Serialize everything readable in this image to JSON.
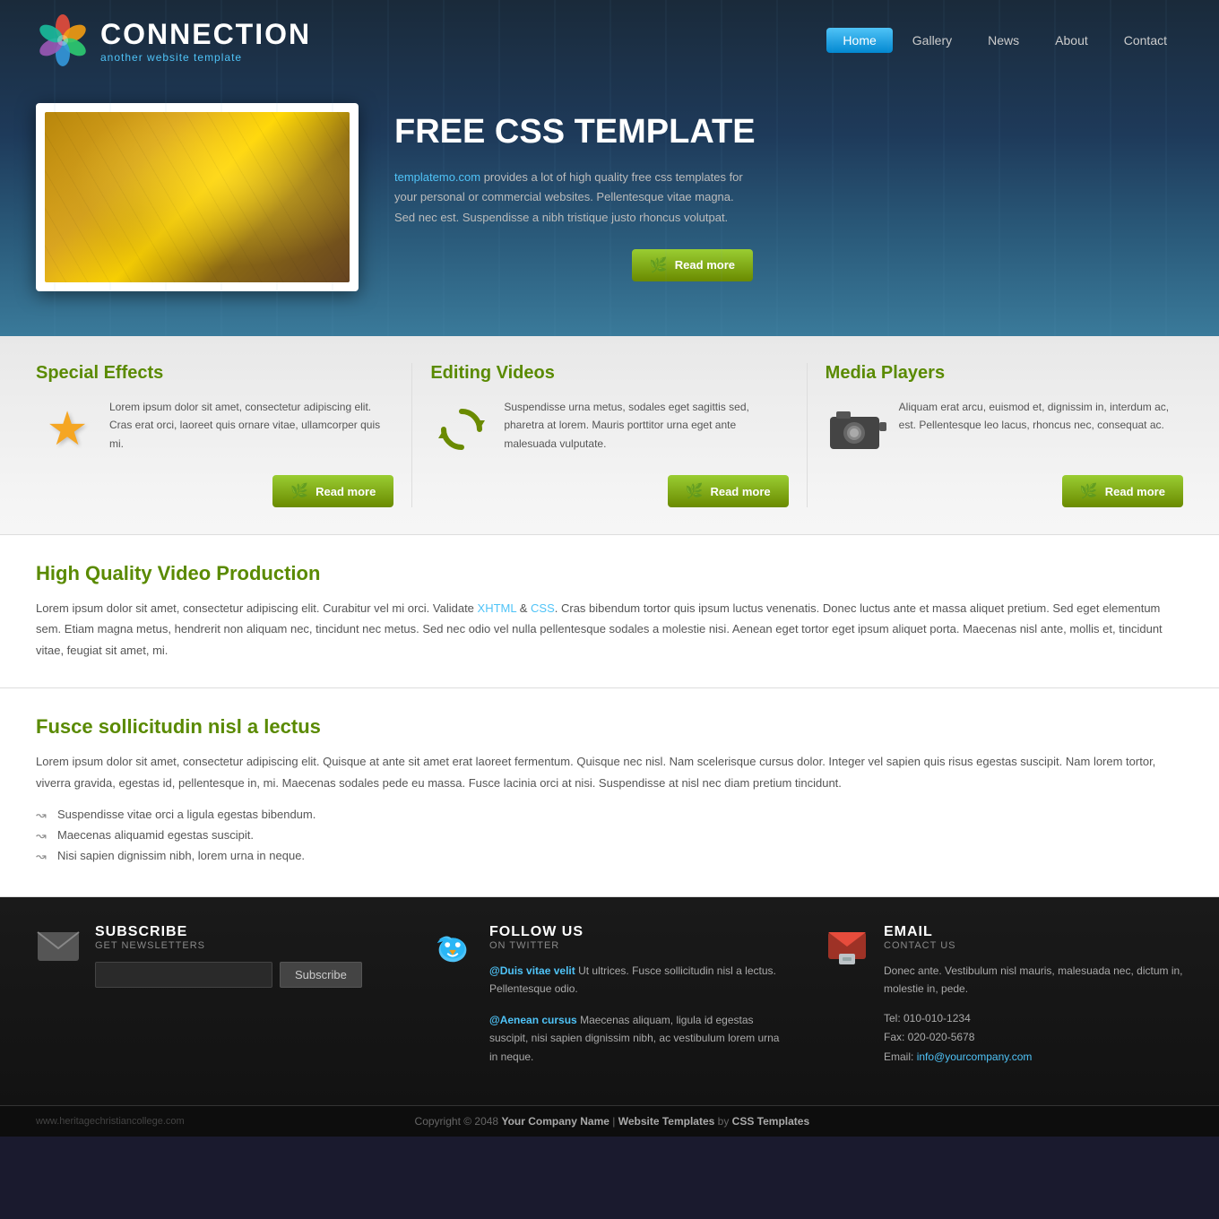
{
  "header": {
    "logo_title": "CONNECTION",
    "logo_subtitle": "another website template",
    "nav": {
      "items": [
        {
          "label": "Home",
          "active": true
        },
        {
          "label": "Gallery",
          "active": false
        },
        {
          "label": "News",
          "active": false
        },
        {
          "label": "About",
          "active": false
        },
        {
          "label": "Contact",
          "active": false
        }
      ]
    }
  },
  "hero": {
    "title": "FREE CSS TEMPLATE",
    "desc_link": "templatemo.com",
    "desc": " provides a lot of high quality free css templates for your personal or commercial websites. Pellentesque vitae magna. Sed nec est. Suspendisse a nibh tristique justo rhoncus volutpat.",
    "read_more": "Read more"
  },
  "features": [
    {
      "title": "Special Effects",
      "text": "Lorem ipsum dolor sit amet, consectetur adipiscing elit. Cras erat orci, laoreet quis ornare vitae, ullamcorper quis mi.",
      "read_more": "Read more"
    },
    {
      "title": "Editing Videos",
      "text": "Suspendisse urna metus, sodales eget sagittis sed, pharetra at lorem. Mauris porttitor urna eget ante malesuada vulputate.",
      "read_more": "Read more"
    },
    {
      "title": "Media Players",
      "text": "Aliquam erat arcu, euismod et, dignissim in, interdum ac, est. Pellentesque leo lacus, rhoncus nec, consequat ac.",
      "read_more": "Read more"
    }
  ],
  "article1": {
    "title": "High Quality Video Production",
    "text": "Lorem ipsum dolor sit amet, consectetur adipiscing elit. Curabitur vel mi orci. Validate ",
    "link1": "XHTML",
    "link1_url": "#",
    "text2": " & ",
    "link2": "CSS",
    "link2_url": "#",
    "text3": ". Cras bibendum tortor quis ipsum luctus venenatis. Donec luctus ante et massa aliquet pretium. Sed eget elementum sem. Etiam magna metus, hendrerit non aliquam nec, tincidunt nec metus. Sed nec odio vel nulla pellentesque sodales a molestie nisi. Aenean eget tortor eget ipsum aliquet porta. Maecenas nisl ante, mollis et, tincidunt vitae, feugiat sit amet, mi."
  },
  "article2": {
    "title": "Fusce sollicitudin nisl a lectus",
    "text": "Lorem ipsum dolor sit amet, consectetur adipiscing elit. Quisque at ante sit amet erat laoreet fermentum. Quisque nec nisl. Nam scelerisque cursus dolor. Integer vel sapien quis risus egestas suscipit. Nam lorem tortor, viverra gravida, egestas id, pellentesque in, mi. Maecenas sodales pede eu massa. Fusce lacinia orci at nisi. Suspendisse at nisl nec diam pretium tincidunt.",
    "list": [
      "Suspendisse vitae orci a ligula egestas bibendum.",
      "Maecenas aliquamid egestas suscipit.",
      "Nisi sapien dignissim nibh, lorem urna in neque."
    ]
  },
  "footer": {
    "subscribe": {
      "title": "SUBSCRIBE",
      "subtitle": "GET NEWSLETTERS",
      "input_placeholder": "",
      "btn_label": "Subscribe"
    },
    "follow": {
      "title": "FOLLOW US",
      "subtitle": "ON TWITTER",
      "entry1_link": "@Duis vitae velit",
      "entry1_text": " Ut ultrices. Fusce sollicitudin nisl a lectus. Pellentesque odio.",
      "entry2_link": "@Aenean cursus",
      "entry2_text": " Maecenas aliquam, ligula id egestas suscipit, nisi sapien dignissim nibh, ac vestibulum lorem urna in neque."
    },
    "email": {
      "title": "EMAIL",
      "subtitle": "CONTACT US",
      "desc": "Donec ante. Vestibulum nisl mauris, malesuada nec, dictum in, molestie in, pede.",
      "tel": "Tel: 010-010-1234",
      "fax": "Fax: 020-020-5678",
      "email_label": "Email: ",
      "email_addr": "info@yourcompany.com"
    },
    "copyright": "Copyright © 2048 ",
    "company_name": "Your Company Name",
    "separator1": " | ",
    "website_templates": "Website Templates",
    "separator2": " by ",
    "css_templates": "CSS Templates",
    "website_url": "www.heritagechristiancollege.com"
  }
}
